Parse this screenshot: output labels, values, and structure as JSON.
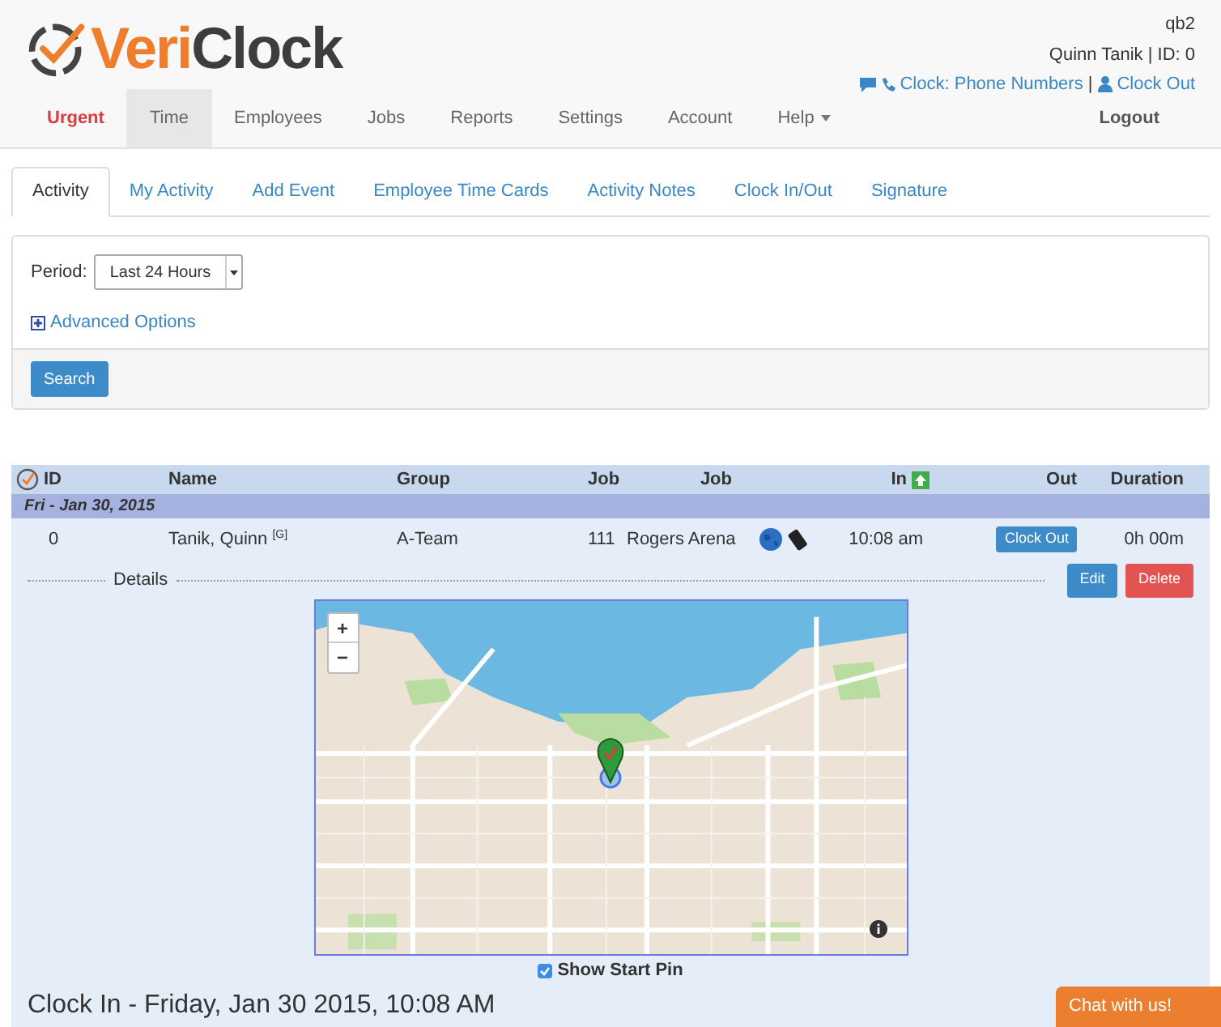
{
  "logo": {
    "part1": "Veri",
    "part2": "Clock"
  },
  "user": {
    "company": "qb2",
    "name_id": "Quinn Tanik | ID: 0",
    "phone_link": "Clock: Phone Numbers",
    "separator": "|",
    "clock_out_link": "Clock Out"
  },
  "nav": [
    {
      "label": "Urgent",
      "kind": "urgent",
      "selected": false
    },
    {
      "label": "Time",
      "kind": "normal",
      "selected": true
    },
    {
      "label": "Employees",
      "kind": "normal",
      "selected": false
    },
    {
      "label": "Jobs",
      "kind": "normal",
      "selected": false
    },
    {
      "label": "Reports",
      "kind": "normal",
      "selected": false
    },
    {
      "label": "Settings",
      "kind": "normal",
      "selected": false
    },
    {
      "label": "Account",
      "kind": "normal",
      "selected": false
    },
    {
      "label": "Help",
      "kind": "dropdown",
      "selected": false
    }
  ],
  "logout": "Logout",
  "tabs": [
    {
      "label": "Activity",
      "selected": true
    },
    {
      "label": "My Activity",
      "selected": false
    },
    {
      "label": "Add Event",
      "selected": false
    },
    {
      "label": "Employee Time Cards",
      "selected": false
    },
    {
      "label": "Activity Notes",
      "selected": false
    },
    {
      "label": "Clock In/Out",
      "selected": false
    },
    {
      "label": "Signature",
      "selected": false
    }
  ],
  "filter": {
    "period_label": "Period:",
    "period_value": "Last 24 Hours",
    "advanced_options": "Advanced Options",
    "search_button": "Search"
  },
  "table": {
    "columns": [
      "ID",
      "Name",
      "Group",
      "Job",
      "Job",
      "In",
      "Out",
      "Duration"
    ],
    "group_row": "Fri - Jan 30, 2015",
    "rows": [
      {
        "id": "0",
        "name": "Tanik, Quinn $^{[G]}$",
        "group": "A-Team",
        "job_number": "111",
        "job_name": "Rogers Arena",
        "in": "10:08 am",
        "out_button": "Clock Out",
        "duration": "0h 00m"
      }
    ],
    "details": {
      "label": "Details",
      "edit": "Edit",
      "delete": "Delete",
      "map": {
        "kind": "picture",
        "zoom_in": "+",
        "zoom_out": "−"
      },
      "show_start_pin": {
        "label": "Show Start Pin",
        "checked": true
      }
    },
    "clock_in_heading": "Clock In - Friday, Jan 30 2015, 10:08 AM"
  },
  "chat_button": "Chat with us!"
}
